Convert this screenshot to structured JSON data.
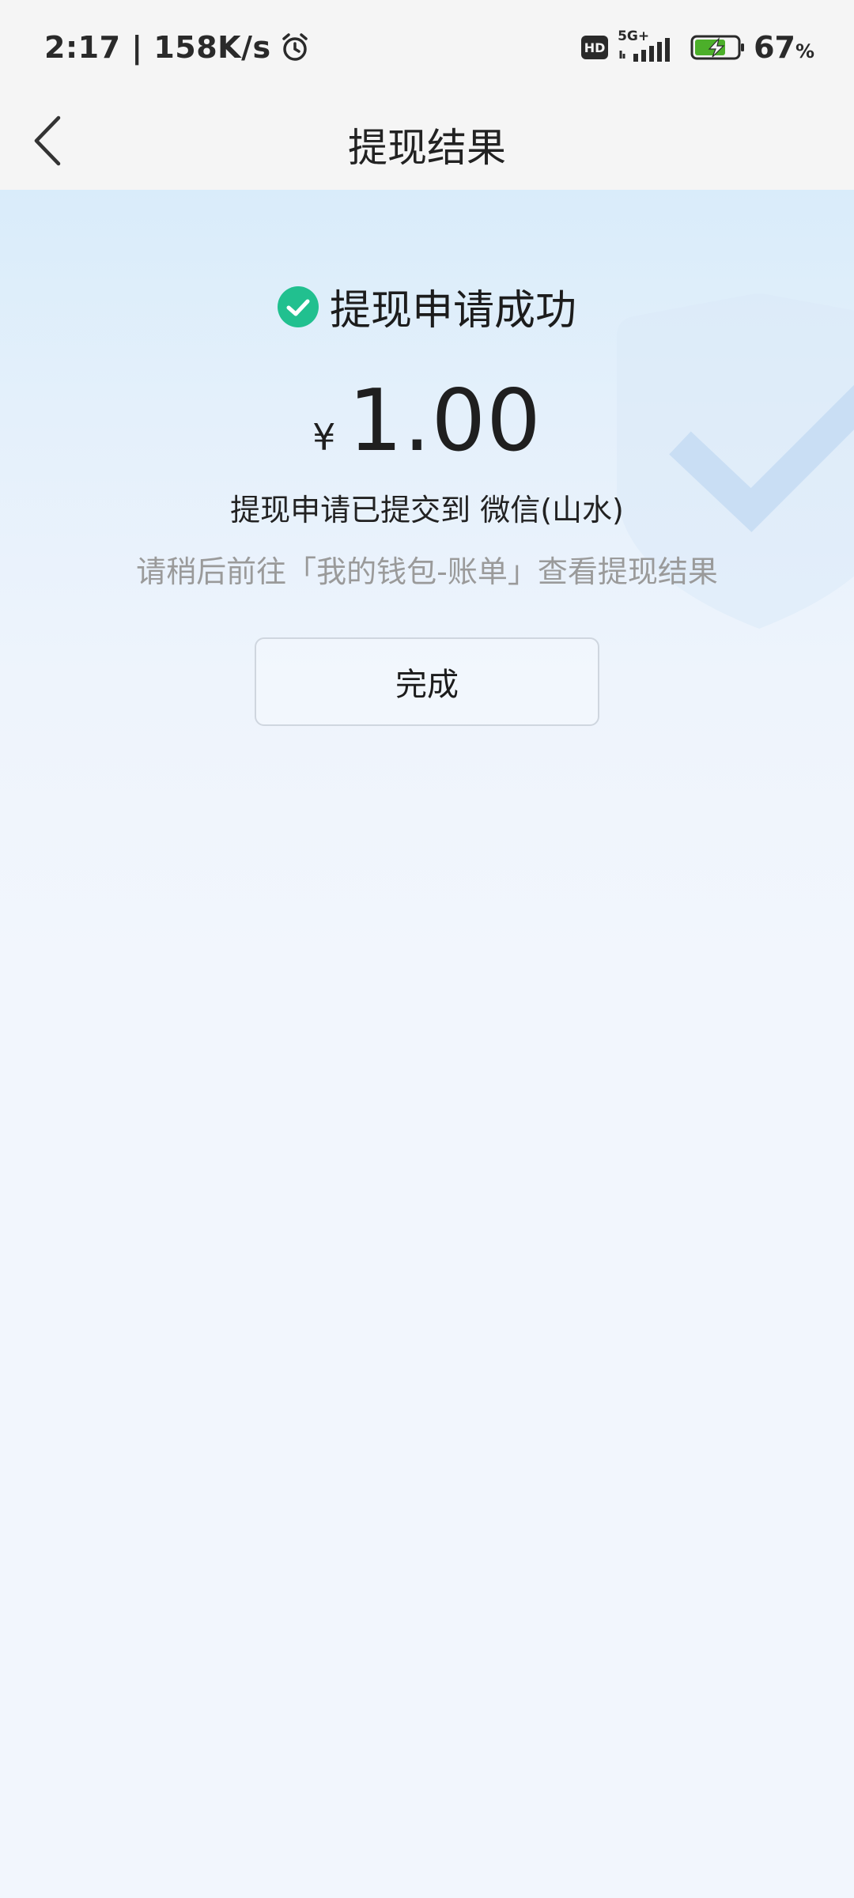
{
  "status_bar": {
    "time_speed": "2:17 | 158K/s",
    "hd_badge": "HD",
    "network_type": "5G+",
    "battery_percent": "67",
    "battery_unit": "%"
  },
  "nav": {
    "title": "提现结果"
  },
  "result": {
    "status_text": "提现申请成功",
    "currency_symbol": "¥",
    "amount": "1.00",
    "submitted_to": "提现申请已提交到 微信(山水)",
    "hint": "请稍后前往「我的钱包-账单」查看提现结果",
    "done_label": "完成"
  },
  "colors": {
    "success_green": "#21c08f",
    "battery_green": "#4caf2a",
    "background_blue": "#d9ecfa"
  }
}
